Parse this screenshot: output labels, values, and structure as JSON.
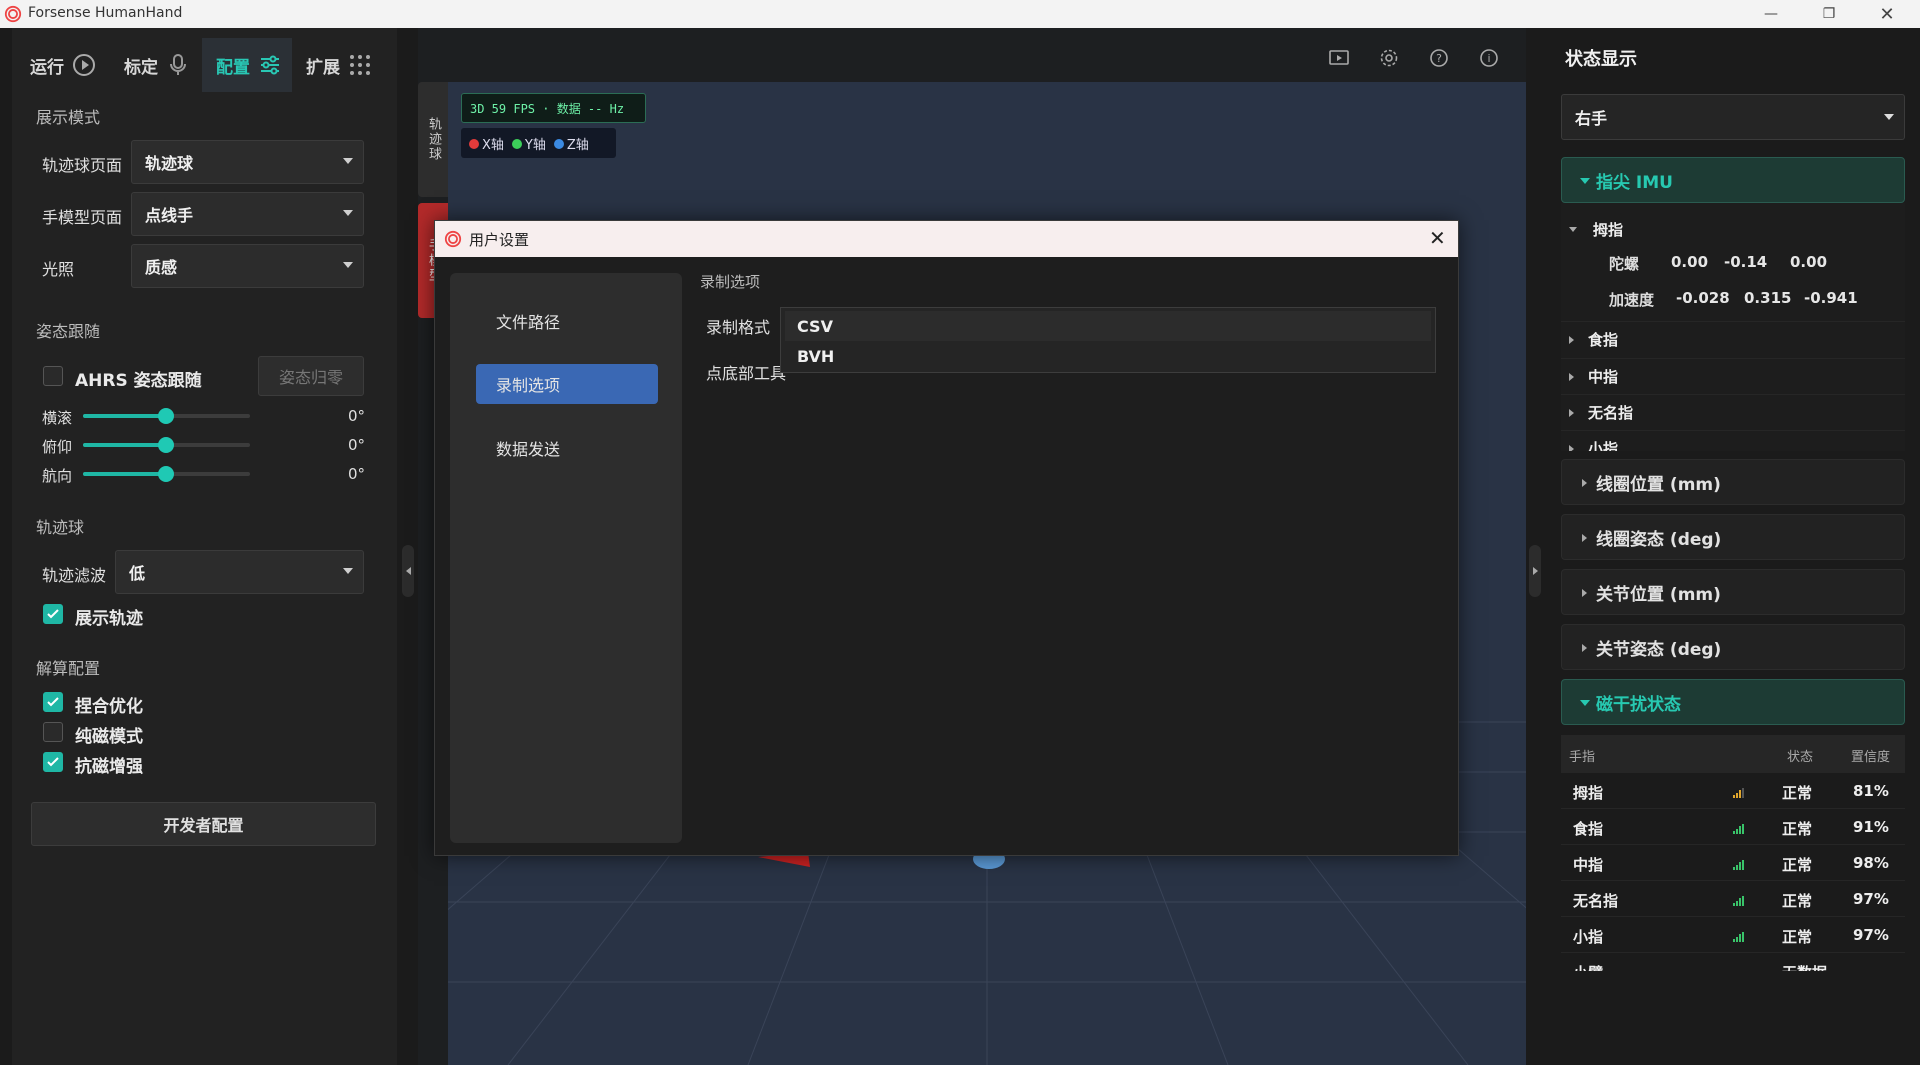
{
  "window": {
    "title": "Forsense HumanHand"
  },
  "top_tabs": [
    {
      "label": "运行",
      "icon": "play-circle-icon"
    },
    {
      "label": "标定",
      "icon": "microphone-icon"
    },
    {
      "label": "配置",
      "icon": "sliders-icon",
      "active": true
    },
    {
      "label": "扩展",
      "icon": "grid-dots-icon"
    }
  ],
  "left": {
    "display_mode": {
      "title": "展示模式",
      "rows": [
        {
          "label": "轨迹球页面",
          "value": "轨迹球"
        },
        {
          "label": "手模型页面",
          "value": "点线手"
        },
        {
          "label": "光照",
          "value": "质感"
        }
      ]
    },
    "pose_follow": {
      "title": "姿态跟随",
      "ahrs_label": "AHRS 姿态跟随",
      "ahrs_checked": false,
      "reset_button": "姿态归零",
      "sliders": [
        {
          "label": "横滚",
          "value": "0°",
          "fraction": 0.5
        },
        {
          "label": "俯仰",
          "value": "0°",
          "fraction": 0.5
        },
        {
          "label": "航向",
          "value": "0°",
          "fraction": 0.5
        }
      ]
    },
    "trackball": {
      "title": "轨迹球",
      "filter_label": "轨迹滤波",
      "filter_value": "低",
      "show_trail_label": "展示轨迹",
      "show_trail_checked": true
    },
    "solver": {
      "title": "解算配置",
      "options": [
        {
          "label": "捏合优化",
          "checked": true
        },
        {
          "label": "纯磁模式",
          "checked": false
        },
        {
          "label": "抗磁增强",
          "checked": true
        }
      ]
    },
    "dev_button": "开发者配置"
  },
  "viewport": {
    "side_tabs": [
      "轨迹球",
      "手模型"
    ],
    "hud_text": "3D 59 FPS · 数据 -- Hz",
    "axes": [
      {
        "label": "X轴",
        "color": "#e23b3b"
      },
      {
        "label": "Y轴",
        "color": "#3ccf5a"
      },
      {
        "label": "Z轴",
        "color": "#3b8ae2"
      }
    ],
    "toolbar_icons": [
      "screen-icon",
      "gear-icon",
      "help-icon",
      "info-icon"
    ]
  },
  "modal": {
    "title": "用户设置",
    "nav": [
      "文件路径",
      "录制选项",
      "数据发送"
    ],
    "active_nav": 1,
    "section_title": "录制选项",
    "rec_format_label": "录制格式",
    "pinch_label": "点底部工具",
    "format_options": [
      "CSV",
      "BVH"
    ]
  },
  "right": {
    "title": "状态显示",
    "hand_select": "右手",
    "imu": {
      "header": "指尖 IMU",
      "thumb": "拇指",
      "gyro_label": "陀螺",
      "gyro": [
        "0.00",
        "-0.14",
        "0.00"
      ],
      "acc_label": "加速度",
      "acc": [
        "-0.028",
        "0.315",
        "-0.941"
      ],
      "fingers": [
        "食指",
        "中指",
        "无名指",
        "小指"
      ]
    },
    "sections": [
      "线圈位置 (mm)",
      "线圈姿态 (deg)",
      "关节位置 (mm)",
      "关节姿态 (deg)"
    ],
    "mag": {
      "header": "磁干扰状态",
      "columns": [
        "手指",
        "状态",
        "置信度"
      ],
      "rows": [
        {
          "finger": "拇指",
          "status": "正常",
          "confidence": "81%",
          "signal": 3
        },
        {
          "finger": "食指",
          "status": "正常",
          "confidence": "91%",
          "signal": 4
        },
        {
          "finger": "中指",
          "status": "正常",
          "confidence": "98%",
          "signal": 4
        },
        {
          "finger": "无名指",
          "status": "正常",
          "confidence": "97%",
          "signal": 4
        },
        {
          "finger": "小指",
          "status": "正常",
          "confidence": "97%",
          "signal": 4
        },
        {
          "finger": "小臂",
          "status": "无数据",
          "confidence": "",
          "signal": 0
        }
      ]
    }
  }
}
